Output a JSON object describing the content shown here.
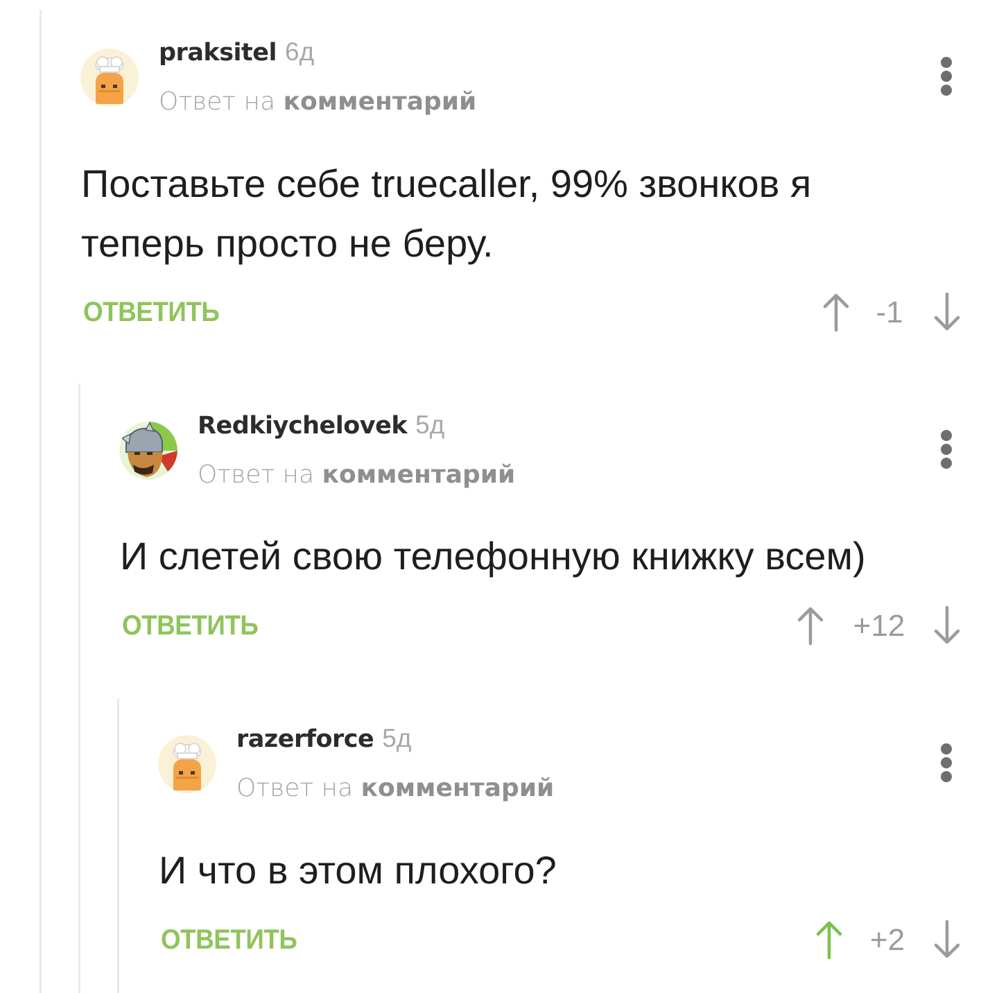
{
  "comments": [
    {
      "username": "praksitel",
      "age": "6д",
      "reply_prefix": "Ответ на",
      "reply_link": "комментарий",
      "lines": [
        "Поставьте себе truecaller, 99% звонков я",
        "теперь просто не беру."
      ],
      "reply_label": "ОТВЕТИТЬ",
      "score": "-1",
      "upvoted": false,
      "avatar": "chef-hat-avatar"
    },
    {
      "username": "Redkiychelovek",
      "age": "5д",
      "reply_prefix": "Ответ на",
      "reply_link": "комментарий",
      "lines": [
        "И слетей свою телефонную книжку всем)"
      ],
      "reply_label": "ОТВЕТИТЬ",
      "score": "+12",
      "upvoted": false,
      "avatar": "warrior-helmet-avatar"
    },
    {
      "username": "razerforce",
      "age": "5д",
      "reply_prefix": "Ответ на",
      "reply_link": "комментарий",
      "lines": [
        "И что в этом плохого?"
      ],
      "reply_label": "ОТВЕТИТЬ",
      "score": "+2",
      "upvoted": true,
      "avatar": "chef-hat-avatar"
    }
  ],
  "colors": {
    "accent_green": "#8fc45a",
    "vote_gray": "#9b9b9b",
    "upvoted_green": "#7cc14b",
    "thread_line": "#e9e9e9"
  }
}
